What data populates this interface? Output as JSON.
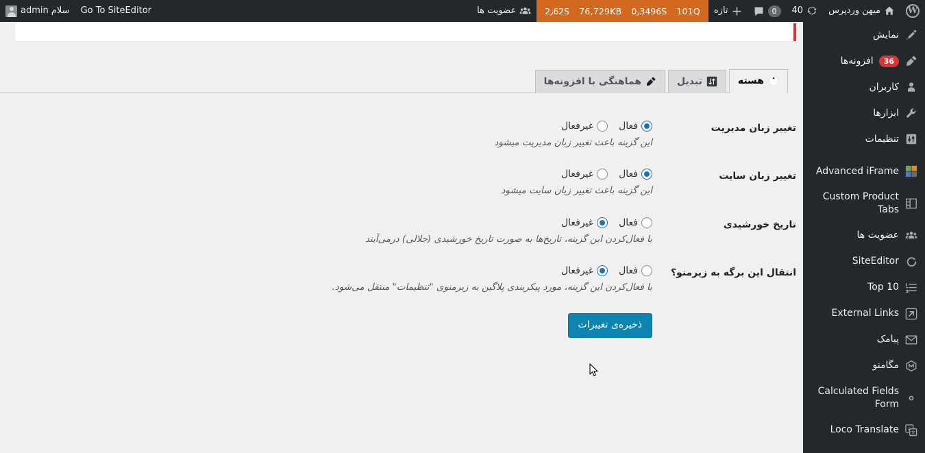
{
  "adminbar": {
    "wp_logo_icon": "wordpress-logo-icon",
    "site_home": {
      "icon": "home-icon",
      "label": "میهن وردپرس"
    },
    "updates": {
      "icon": "updates-icon",
      "count": "40"
    },
    "comments": {
      "icon": "comment-bubble-icon",
      "count": "0"
    },
    "new": {
      "icon": "plus-icon",
      "label": "تازه"
    },
    "performance": {
      "queries": "101Q",
      "time": "0٫3496S",
      "memory": "76,729KB",
      "total": "2٫62S"
    },
    "members": {
      "icon": "group-icon",
      "label": "عضویت ها"
    },
    "site_editor_link": "Go To SiteEditor",
    "greeting": "سلام admin",
    "avatar_icon": "avatar-icon"
  },
  "sidebar": {
    "items": [
      {
        "label": "نمایش",
        "icon": "appearance-brush-icon",
        "badge": null,
        "ltr": false
      },
      {
        "label": "افزونه‌ها",
        "icon": "plugins-plug-icon",
        "badge": "36",
        "ltr": false
      },
      {
        "label": "کاربران",
        "icon": "users-icon",
        "badge": null,
        "ltr": false
      },
      {
        "label": "ابزارها",
        "icon": "tools-wrench-icon",
        "badge": null,
        "ltr": false
      },
      {
        "label": "تنظیمات",
        "icon": "settings-sliders-icon",
        "badge": null,
        "ltr": false
      },
      {
        "label": "Advanced iFrame",
        "icon": "advanced-iframe-icon",
        "badge": null,
        "ltr": true
      },
      {
        "label": "Custom Product Tabs",
        "icon": "custom-product-tabs-icon",
        "badge": null,
        "ltr": true
      },
      {
        "label": "عضویت ها",
        "icon": "group-icon",
        "badge": null,
        "ltr": false
      },
      {
        "label": "SiteEditor",
        "icon": "siteeditor-icon",
        "badge": null,
        "ltr": true
      },
      {
        "label": "Top 10",
        "icon": "top10-list-icon",
        "badge": null,
        "ltr": true
      },
      {
        "label": "External Links",
        "icon": "external-link-icon",
        "badge": null,
        "ltr": true
      },
      {
        "label": "پیامک",
        "icon": "email-envelope-icon",
        "badge": null,
        "ltr": false
      },
      {
        "label": "مگامنو",
        "icon": "megamenu-box-icon",
        "badge": null,
        "ltr": false
      },
      {
        "label": "Calculated Fields Form",
        "icon": "gear-icon",
        "badge": null,
        "ltr": true
      },
      {
        "label": "Loco Translate",
        "icon": "translate-icon",
        "badge": null,
        "ltr": true
      }
    ]
  },
  "tabs": [
    {
      "label": "هسته",
      "icon": "globe-icon",
      "active": true
    },
    {
      "label": "تبدیل",
      "icon": "convert-icon",
      "active": false
    },
    {
      "label": "هماهنگی با افزونه‌ها",
      "icon": "plug-icon",
      "active": false
    }
  ],
  "settings": {
    "rows": [
      {
        "title": "تغییر زبان مدیریت",
        "enabled_label": "فعال",
        "disabled_label": "غیرفعال",
        "selected": "enabled",
        "description": "این گزینه باعث تغییر زبان مدیریت میشود"
      },
      {
        "title": "تغییر زبان سایت",
        "enabled_label": "فعال",
        "disabled_label": "غیرفعال",
        "selected": "enabled",
        "description": "این گزینه باعث تغییر زبان سایت میشود"
      },
      {
        "title": "تاریخ خورشیدی",
        "enabled_label": "فعال",
        "disabled_label": "غیرفعال",
        "selected": "disabled",
        "description": "با فعال‌کردن این گزینه، تاریخ‌ها به صورت تاریخ خورشیدی (جلالی) درمی‌آیند"
      },
      {
        "title": "انتقال این برگه به زیرمنو؟",
        "enabled_label": "فعال",
        "disabled_label": "غیرفعال",
        "selected": "disabled",
        "description": "با فعال‌کردن این گزینه، مورد پیکربندی پلاگین به زیرمنوی \"تنظیمات\" منتقل می‌شود."
      }
    ],
    "save_label": "ذخیره‌ی تغییرات"
  },
  "colors": {
    "adminbar_bg": "#23282d",
    "perf_bg": "#d2691e",
    "accent": "#2271b1",
    "primary_button": "#0e84b0",
    "badge_red": "#d63638",
    "content_bg": "#f0f0f1"
  }
}
